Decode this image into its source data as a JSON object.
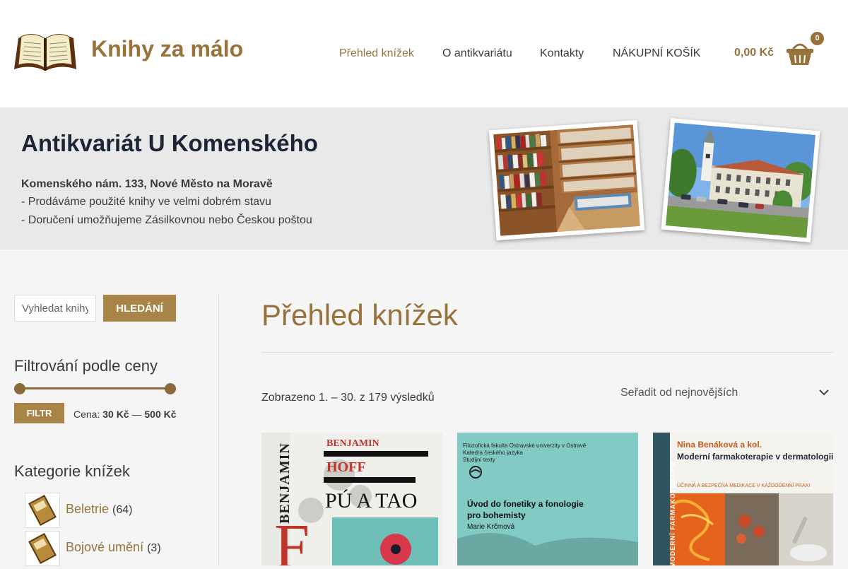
{
  "header": {
    "site_title": "Knihy za málo",
    "nav": [
      "Přehled knížek",
      "O antikvariátu",
      "Kontakty",
      "NÁKUPNÍ KOŠÍK"
    ],
    "cart_total": "0,00 Kč",
    "cart_count": "0"
  },
  "hero": {
    "title": "Antikvariát U Komenského",
    "address": "Komenského nám. 133, Nové Město na Moravě",
    "line1": "- Prodáváme použité knihy ve velmi dobrém stavu",
    "line2": "- Doručení umožňujeme Zásilkovnou nebo Českou poštou"
  },
  "sidebar": {
    "search_placeholder": "Vyhledat knihy…",
    "search_button": "HLEDÁNÍ",
    "price_filter_title": "Filtrování podle ceny",
    "filter_button": "FILTR",
    "price_prefix": "Cena:",
    "price_min": "30 Kč",
    "price_sep": "—",
    "price_max": "500 Kč",
    "categories_title": "Kategorie knížek",
    "categories": [
      {
        "name": "Beletrie",
        "count": "(64)"
      },
      {
        "name": "Bojové umění",
        "count": "(3)"
      }
    ]
  },
  "main": {
    "title": "Přehled knížek",
    "result_count": "Zobrazeno 1. – 30. z 179 výsledků",
    "sort_label": "Seřadit od nejnovějších"
  },
  "products": [
    {
      "cover_author_vertical": "BENJAMIN",
      "cover_author": "BENJAMIN",
      "cover_surname": "HOFF",
      "cover_title": "PÚ A TAO",
      "cover_big": "F"
    },
    {
      "cover_header1": "Filozofická fakulta Ostravské univerzity v Ostravě",
      "cover_header2": "Katedra českého jazyka",
      "cover_header3": "Studijní texty",
      "cover_title1": "Úvod do fonetiky a fonologie",
      "cover_title2": "pro bohemisty",
      "cover_author": "Marie Krčmová"
    },
    {
      "cover_vertical": "MODERNÍ FARMAKOTERAPIE",
      "cover_author": "Nina Benáková a kol.",
      "cover_title": "Moderní farmakoterapie v dermatologii",
      "cover_subtitle": "ÚČINNÁ A BEZPEČNÁ MEDIKACE V KAŽDODENNÍ PRAXI"
    }
  ],
  "colors": {
    "accent": "#97733b",
    "button": "#a98447",
    "hero_bg": "#e9e9e9"
  }
}
